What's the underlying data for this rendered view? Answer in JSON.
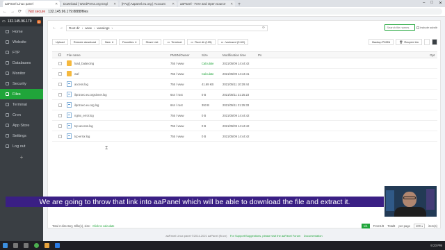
{
  "browser": {
    "tabs": [
      {
        "title": "aaPanel Linux panel",
        "active": true
      },
      {
        "title": "Download | WordPress.org Engl",
        "active": false
      },
      {
        "title": "[FAQ] Aapanel.eu.org | Account",
        "active": false
      },
      {
        "title": "aaPanel - Free and Open source",
        "active": false
      }
    ],
    "new_tab": "+",
    "window_controls": {
      "minimize": "–",
      "maximize": "□",
      "close": "✕"
    },
    "nav": {
      "back": "←",
      "forward": "→",
      "reload": "⟳"
    },
    "url": {
      "security": "Not secure",
      "host": "132.145.96.179:8888/files"
    }
  },
  "sidebar": {
    "server_ip": "132.145.96.179",
    "badge": "0",
    "items": [
      {
        "label": "Home",
        "active": false
      },
      {
        "label": "Website",
        "active": false
      },
      {
        "label": "FTP",
        "active": false
      },
      {
        "label": "Databases",
        "active": false
      },
      {
        "label": "Monitor",
        "active": false
      },
      {
        "label": "Security",
        "active": false
      },
      {
        "label": "Files",
        "active": true
      },
      {
        "label": "Terminal",
        "active": false
      },
      {
        "label": "Cron",
        "active": false
      },
      {
        "label": "App Store",
        "active": false
      },
      {
        "label": "Settings",
        "active": false
      },
      {
        "label": "Log out",
        "active": false
      }
    ],
    "add": "+"
  },
  "pathbar": {
    "back": "←",
    "forward": "→",
    "segments": [
      "Root dir",
      "www",
      "wwwlogs"
    ],
    "search_placeholder": "Search file names",
    "subdir_label": "include subdir"
  },
  "toolbar": {
    "buttons": [
      "Upload",
      "Remote download",
      "New",
      "Favorites",
      "Share List",
      "Terminal",
      "Root dir (105)",
      "/var/used (9.6G)"
    ],
    "right_buttons": [
      "Backup PMSN",
      "Recycle bin"
    ]
  },
  "table": {
    "headers": [
      "File name",
      "PMSN/Owner",
      "Size",
      "Modification time",
      "Ps",
      "Opt"
    ],
    "rows": [
      {
        "name": "load_balancing",
        "type": "folder",
        "perm": "755 / www",
        "size": "Calculate",
        "mtime": "2021/05/09 14:44:42"
      },
      {
        "name": "waf",
        "type": "folder",
        "perm": "755 / www",
        "size": "Calculate",
        "mtime": "2021/05/09 14:44:41"
      },
      {
        "name": "access.log",
        "type": "file",
        "perm": "755 / www",
        "size": "41.69 KB",
        "mtime": "2021/05/11 10:29:44"
      },
      {
        "name": "ilpnzoeo.eu.orgsinner.log",
        "type": "file",
        "perm": "644 / root",
        "size": "0 B",
        "mtime": "2021/05/11 21:25:23"
      },
      {
        "name": "ilpnzoeo.eu.org.log",
        "type": "file",
        "perm": "644 / root",
        "size": "393 B",
        "mtime": "2021/05/11 21:25:33"
      },
      {
        "name": "nginx_error.log",
        "type": "file",
        "perm": "755 / www",
        "size": "0 B",
        "mtime": "2021/05/09 14:44:42"
      },
      {
        "name": "tcp-access.log",
        "type": "file",
        "perm": "755 / www",
        "size": "0 B",
        "mtime": "2021/05/09 14:44:42"
      },
      {
        "name": "tcp-error.log",
        "type": "file",
        "perm": "755 / www",
        "size": "0 B",
        "mtime": "2021/05/09 14:44:42"
      }
    ]
  },
  "footer": {
    "summary": "Total 2 directory, 6file(s), size:",
    "calc_link": "Click to calculate",
    "page_current": "1/1",
    "page_from": "From1/8",
    "total": "Total8",
    "per_page_label": "per page",
    "per_page": "100",
    "item": "item(s)"
  },
  "copyright": {
    "text": "aaPanel Linux panel ©2014-2021 aaPanel (Bt.cn)",
    "support": "For Support/Suggestions, please visit the aaPanel Forum",
    "docs": "Documentation"
  },
  "overlay": {
    "subtitle": "We are going to throw that link into aaPanel which will be able to download the file and extract it."
  },
  "taskbar": {
    "clock": "9:23 PM"
  }
}
